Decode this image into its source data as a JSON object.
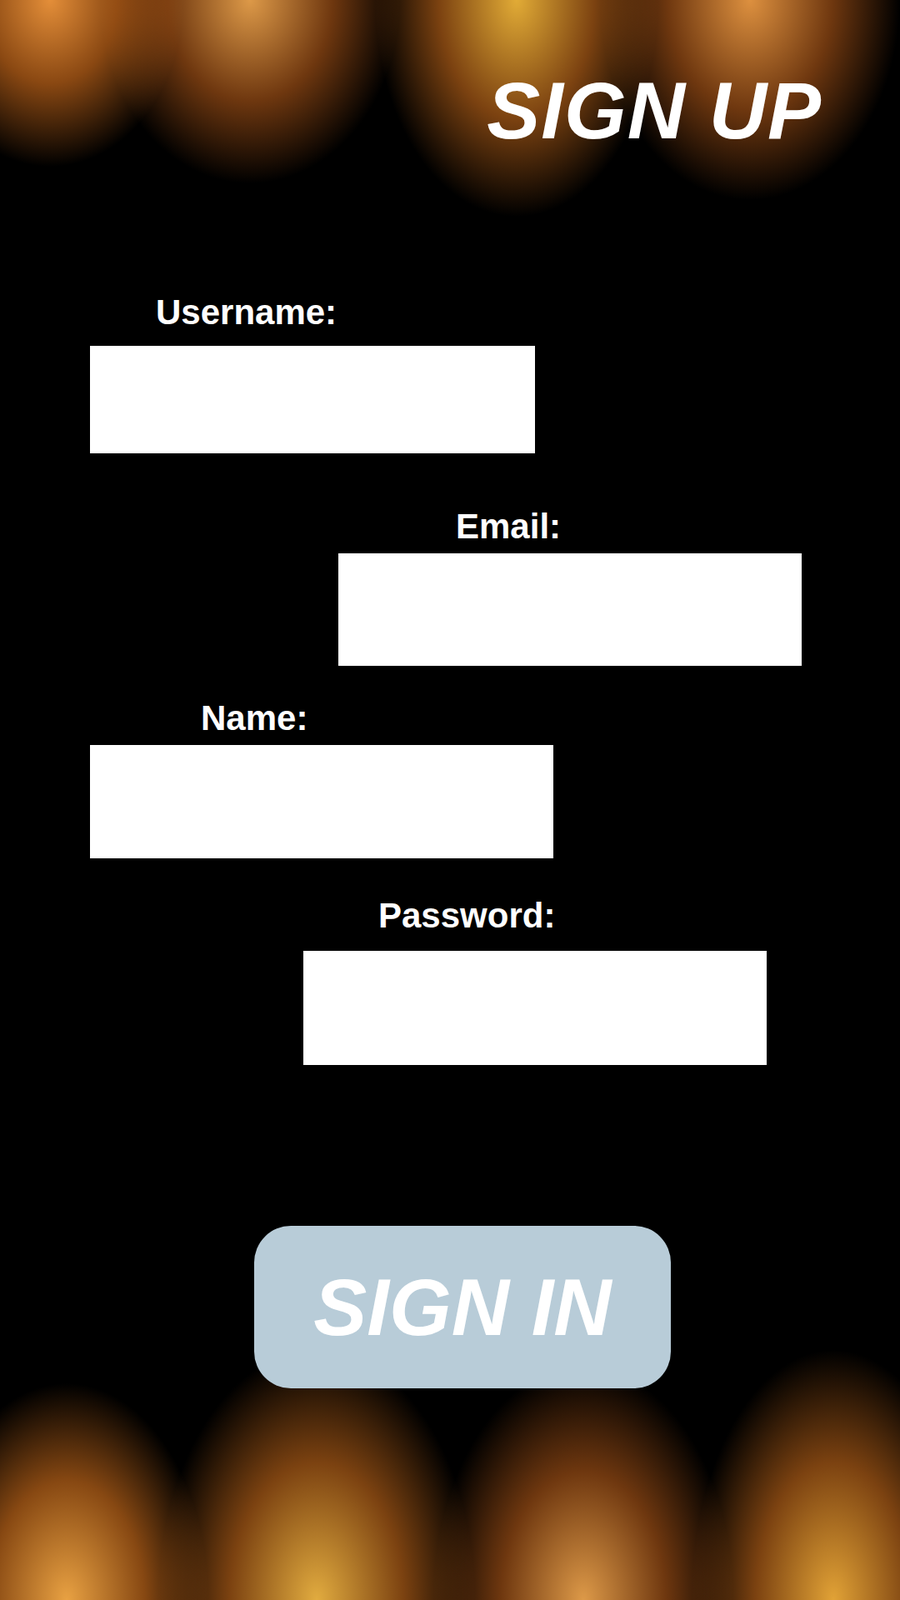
{
  "title": "SIGN UP",
  "fields": [
    {
      "label": "Username:"
    },
    {
      "label": "Email:"
    },
    {
      "label": "Name:"
    },
    {
      "label": "Password:"
    }
  ],
  "button": "SIGN IN"
}
